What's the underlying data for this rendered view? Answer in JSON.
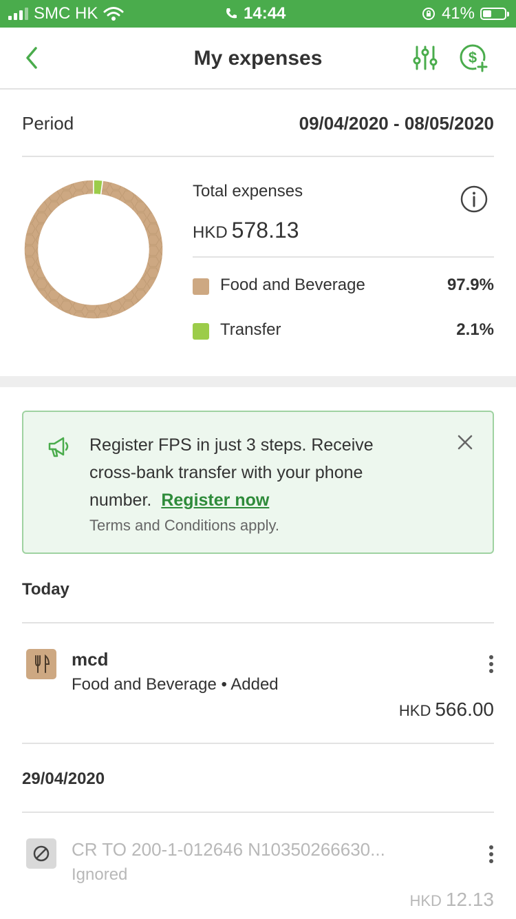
{
  "status_bar": {
    "carrier": "SMC HK",
    "time": "14:44",
    "battery_percent": "41%",
    "battery_level": 0.41
  },
  "header": {
    "title": "My expenses",
    "icons": [
      "back-chevron-icon",
      "filter-sliders-icon",
      "add-expense-icon"
    ]
  },
  "period": {
    "label": "Period",
    "value": "09/04/2020 - 08/05/2020"
  },
  "summary": {
    "total_label": "Total expenses",
    "currency": "HKD",
    "total_amount": "578.13",
    "categories": [
      {
        "name": "Food and Beverage",
        "percent": "97.9%",
        "share": 97.9,
        "color": "#cda882"
      },
      {
        "name": "Transfer",
        "percent": "2.1%",
        "share": 2.1,
        "color": "#9ccc4a"
      }
    ]
  },
  "promo": {
    "text": "Register FPS in just 3 steps. Receive cross-bank transfer with your phone number.",
    "link": "Register now",
    "terms": "Terms and Conditions apply."
  },
  "groups": [
    {
      "label": "Today",
      "items": [
        {
          "title": "mcd",
          "subtitle": "Food and Beverage • Added",
          "currency": "HKD",
          "amount": "566.00",
          "icon": "cutlery-icon"
        }
      ]
    },
    {
      "label": "29/04/2020",
      "items": [
        {
          "title": "CR TO 200-1-012646 N10350266630...",
          "subtitle": "Ignored",
          "currency": "HKD",
          "amount": "12.13",
          "icon": "blocked-icon"
        }
      ]
    }
  ],
  "colors": {
    "brand_green": "#4aac4c",
    "link_green": "#2e8b3a",
    "food": "#cda882",
    "transfer": "#9ccc4a"
  }
}
